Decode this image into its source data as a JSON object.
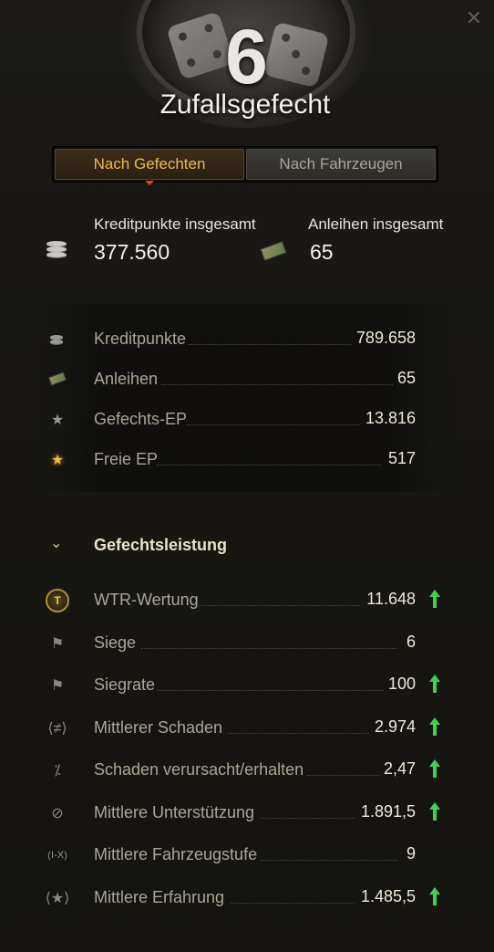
{
  "header": {
    "mode_number": "6",
    "mode_title": "Zufallsgefecht",
    "close_icon": "close-icon"
  },
  "tabs": [
    {
      "label": "Nach Gefechten",
      "active": true
    },
    {
      "label": "Nach Fahrzeugen",
      "active": false
    }
  ],
  "totals": {
    "credits_label": "Kreditpunkte insgesamt",
    "credits_value": "377.560",
    "bonds_label": "Anleihen insgesamt",
    "bonds_value": "65"
  },
  "resources": [
    {
      "label": "Kreditpunkte",
      "value": "789.658",
      "icon": "credits-icon"
    },
    {
      "label": "Anleihen",
      "value": "65",
      "icon": "bonds-icon"
    },
    {
      "label": "Gefechts-EP",
      "value": "13.816",
      "icon": "star-icon"
    },
    {
      "label": "Freie EP",
      "value": "517",
      "icon": "free-xp-star-icon"
    }
  ],
  "performance": {
    "title": "Gefechtsleistung",
    "rows": [
      {
        "label": "WTR-Wertung",
        "value": "11.648",
        "trend": "up",
        "icon": "wtr-badge-icon"
      },
      {
        "label": "Siege",
        "value": "6",
        "trend": "",
        "icon": "flag-icon"
      },
      {
        "label": "Siegrate",
        "value": "100",
        "trend": "up",
        "icon": "flag-icon"
      },
      {
        "label": "Mittlerer Schaden",
        "value": "2.974",
        "trend": "up",
        "icon": "damage-icon"
      },
      {
        "label": "Schaden verursacht/erhalten",
        "value": "2,47",
        "trend": "up",
        "icon": "damage-ratio-icon"
      },
      {
        "label": "Mittlere Unterstützung",
        "value": "1.891,5",
        "trend": "up",
        "icon": "assist-icon"
      },
      {
        "label": "Mittlere Fahrzeugstufe",
        "value": "9",
        "trend": "",
        "icon": "tier-icon",
        "tier_text": "I-X"
      },
      {
        "label": "Mittlere Erfahrung",
        "value": "1.485,5",
        "trend": "up",
        "icon": "xp-star-icon"
      }
    ]
  },
  "colors": {
    "active_tab_text": "#f2b84a",
    "trend_up": "#3fd24a",
    "value_text": "#efe9d9"
  }
}
